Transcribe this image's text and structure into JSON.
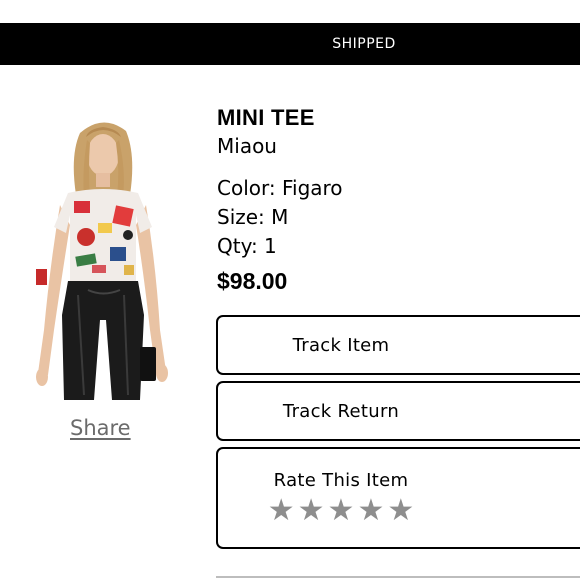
{
  "status": {
    "label": "SHIPPED"
  },
  "product": {
    "title": "MINI TEE",
    "brand": "Miaou",
    "color": "Color: Figaro",
    "size": "Size: M",
    "qty": "Qty: 1",
    "price": "$98.00",
    "image_alt": "model-wearing-mini-tee"
  },
  "actions": {
    "share_label": "Share",
    "track_item_label": "Track Item",
    "track_return_label": "Track Return",
    "rate_label": "Rate This Item"
  },
  "rating": {
    "max_stars": 5,
    "current": 0,
    "star_glyph": "★",
    "star_color": "#8e8e8e"
  },
  "colors": {
    "status_bar_bg": "#000000",
    "status_bar_text": "#ffffff",
    "share_link": "#6b6b6b"
  }
}
